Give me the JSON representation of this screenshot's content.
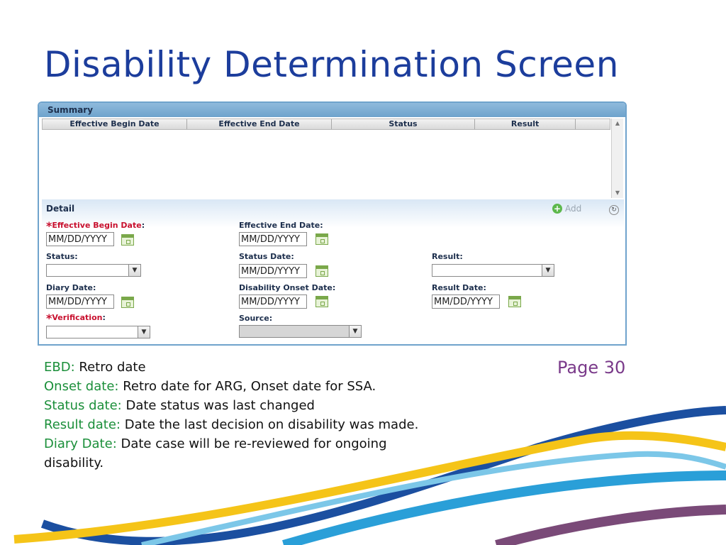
{
  "slide": {
    "title": "Disability Determination Screen",
    "page_label": "Page 30"
  },
  "summary": {
    "title": "Summary",
    "columns": [
      "Effective Begin Date",
      "Effective End Date",
      "Status",
      "Result"
    ],
    "rows": []
  },
  "detail": {
    "title": "Detail",
    "add_label": "Add",
    "fields": {
      "effective_begin_date": {
        "label": "Effective Begin Date",
        "value": "MM/DD/YYYY",
        "required": true
      },
      "effective_end_date": {
        "label": "Effective End Date",
        "value": "MM/DD/YYYY"
      },
      "status": {
        "label": "Status",
        "value": ""
      },
      "status_date": {
        "label": "Status Date",
        "value": "MM/DD/YYYY"
      },
      "result": {
        "label": "Result",
        "value": ""
      },
      "diary_date": {
        "label": "Diary Date",
        "value": "MM/DD/YYYY"
      },
      "disability_onset_date": {
        "label": "Disability Onset Date",
        "value": "MM/DD/YYYY"
      },
      "result_date": {
        "label": "Result Date",
        "value": "MM/DD/YYYY"
      },
      "verification": {
        "label": "Verification",
        "value": "",
        "required": true
      },
      "source": {
        "label": "Source",
        "value": "",
        "disabled": true
      }
    }
  },
  "notes": [
    {
      "term": "EBD:",
      "text": " Retro date"
    },
    {
      "term": "Onset date:",
      "text": " Retro date for ARG, Onset date for SSA."
    },
    {
      "term": "Status date:",
      "text": " Date status was last changed"
    },
    {
      "term": "Result date:",
      "text": " Date the last decision on disability was made."
    },
    {
      "term": "Diary Date:",
      "text": " Date case will be re-reviewed for ongoing"
    },
    {
      "term": "",
      "text": "disability."
    }
  ],
  "colors": {
    "title": "#1c3d9c",
    "note_term": "#1b8f3a",
    "page_label": "#7a3a8a",
    "required": "#c8102e"
  }
}
